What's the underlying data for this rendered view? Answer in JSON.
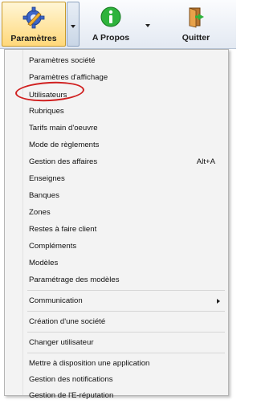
{
  "toolbar": {
    "parametres_label": "Paramètres",
    "apropos_label": "A Propos",
    "quitter_label": "Quitter"
  },
  "menu": {
    "items": [
      {
        "label": "Paramètres société"
      },
      {
        "label": "Paramètres d'affichage"
      },
      {
        "label": "Utilisateurs"
      },
      {
        "label": "Rubriques"
      },
      {
        "label": "Tarifs main d'oeuvre"
      },
      {
        "label": "Mode de règlements"
      },
      {
        "label": "Gestion des affaires",
        "shortcut": "Alt+A"
      },
      {
        "label": "Enseignes"
      },
      {
        "label": "Banques"
      },
      {
        "label": "Zones"
      },
      {
        "label": "Restes à faire client"
      },
      {
        "label": "Compléments"
      },
      {
        "label": "Modèles"
      },
      {
        "label": "Paramétrage des modèles"
      },
      {
        "label": "Communication"
      },
      {
        "label": "Création d'une société"
      },
      {
        "label": "Changer utilisateur"
      },
      {
        "label": "Mettre à disposition une application"
      },
      {
        "label": "Gestion des notifications"
      },
      {
        "label": "Gestion de l'E-réputation"
      }
    ]
  },
  "colors": {
    "active_button": "#ffd87a",
    "highlight_circle": "#d02020",
    "menu_background": "#f3f3f3"
  }
}
